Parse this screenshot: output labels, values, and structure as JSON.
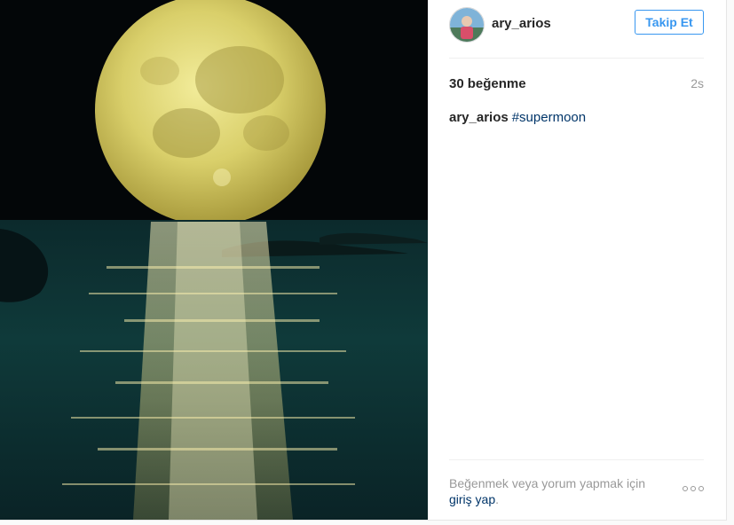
{
  "post": {
    "image_alt": "supermoon",
    "author": {
      "username": "ary_arios"
    },
    "follow_label": "Takip Et",
    "likes": {
      "count": "30",
      "label": "beğenme"
    },
    "timestamp": "2s",
    "caption": {
      "username": "ary_arios",
      "hashtag": "#supermoon"
    },
    "login_prompt": {
      "text": "Beğenmek veya yorum yapmak için",
      "link": "giriş yap",
      "suffix": "."
    },
    "more_icon": "more-options-icon"
  },
  "colors": {
    "accent": "#3897f0",
    "link": "#003569",
    "muted": "#999999",
    "text": "#262626"
  }
}
